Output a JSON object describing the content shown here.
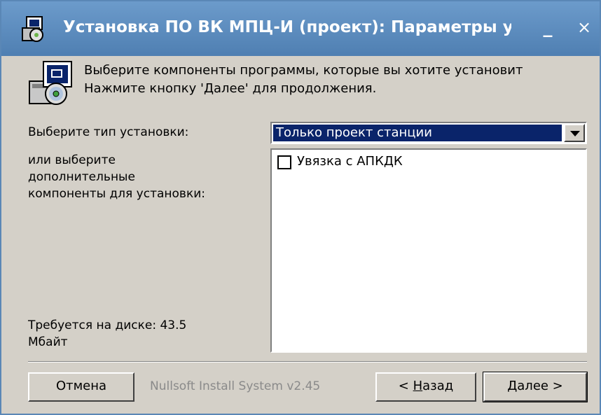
{
  "window": {
    "title": "Установка ПО ВК МПЦ-И (проект): Параметры ус..",
    "minimize_glyph": "_",
    "close_glyph": "×",
    "title_icon": "installer-icon"
  },
  "header": {
    "icon": "installer-disk-icon",
    "line1": "Выберите компоненты программы, которые вы хотите установит",
    "line2": "Нажмите кнопку 'Далее' для продолжения."
  },
  "install_type": {
    "label": "Выберите тип установки:",
    "selected": "Только проект станции"
  },
  "components": {
    "label_line1": "или выберите",
    "label_line2": "дополнительные",
    "label_line3": "компоненты для установки:",
    "items": [
      {
        "label": "Увязка с АПКДК",
        "checked": false
      }
    ]
  },
  "disk": {
    "line1": "Требуется на диске: 43.5",
    "line2": "Мбайт"
  },
  "footer": {
    "cancel_label": "Отмена",
    "branding": "Nullsoft Install System v2.45",
    "back_prefix": "< ",
    "back_hotkey": "Н",
    "back_rest": "азад",
    "next_hotkey": "Д",
    "next_rest": "алее >"
  },
  "colors": {
    "titlebar": "#5a8bbd",
    "face": "#d4d0c8",
    "selection": "#0a246a"
  }
}
